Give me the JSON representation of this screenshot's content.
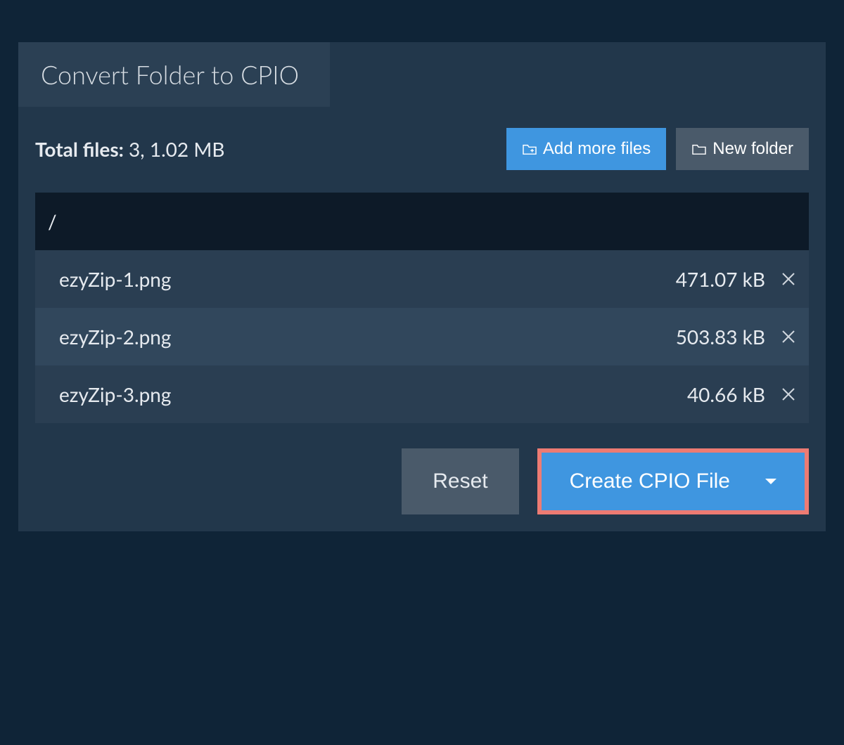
{
  "tab_title": "Convert Folder to CPIO",
  "summary": {
    "label": "Total files:",
    "count": "3",
    "size": "1.02 MB"
  },
  "buttons": {
    "add_more": "Add more files",
    "new_folder": "New folder",
    "reset": "Reset",
    "create": "Create CPIO File"
  },
  "path": "/",
  "files": [
    {
      "name": "ezyZip-1.png",
      "size": "471.07 kB"
    },
    {
      "name": "ezyZip-2.png",
      "size": "503.83 kB"
    },
    {
      "name": "ezyZip-3.png",
      "size": "40.66 kB"
    }
  ]
}
